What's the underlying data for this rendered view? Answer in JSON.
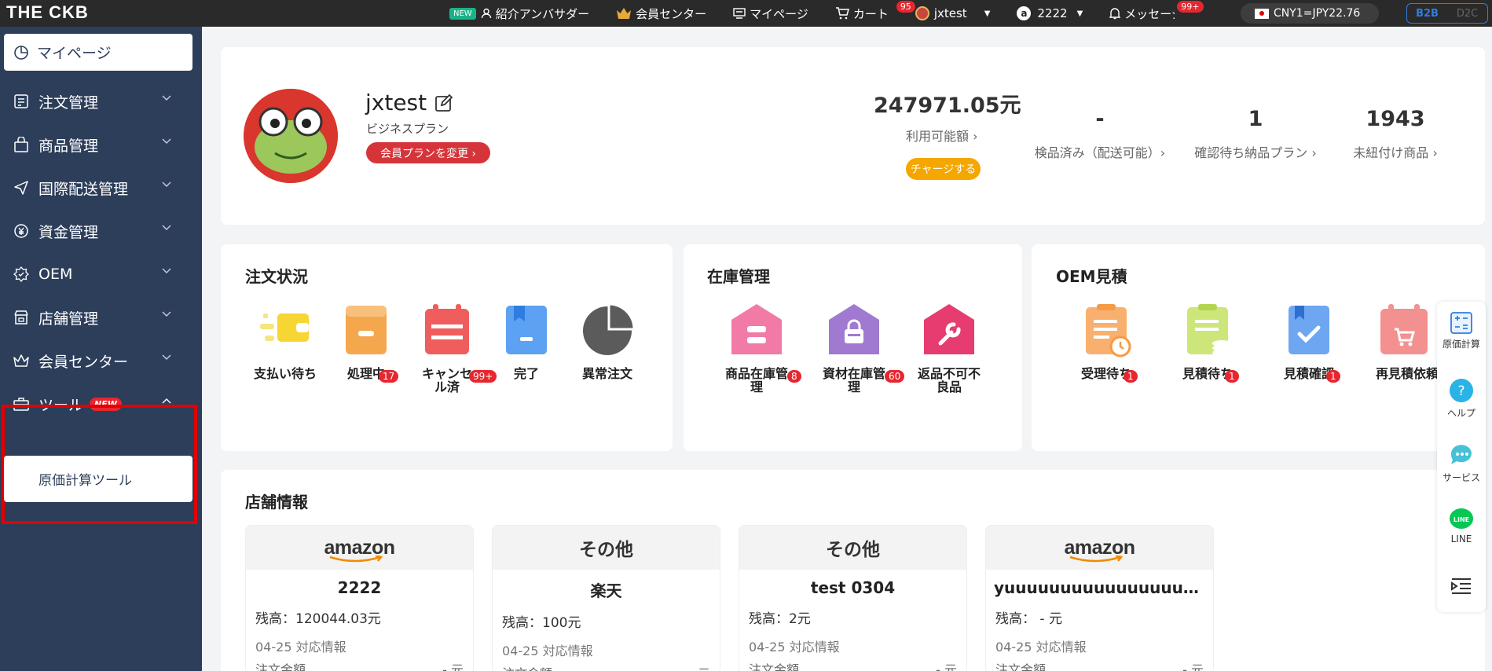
{
  "topbar": {
    "logo": "THE CKB",
    "new_badge": "NEW",
    "ambassador": "紹介アンバサダー",
    "member_center": "会員センター",
    "mypage": "マイページ",
    "cart": "カート",
    "cart_count": "95",
    "user": "jxtest",
    "amazon_account": "2222",
    "messages": "メッセージ",
    "messages_count": "99+",
    "rate": "CNY1=JPY22.76",
    "mode_b2b": "B2B",
    "mode_d2c": "D2C"
  },
  "sidebar": {
    "mypage": "マイページ",
    "items": [
      {
        "label": "注文管理"
      },
      {
        "label": "商品管理"
      },
      {
        "label": "国際配送管理"
      },
      {
        "label": "資金管理"
      },
      {
        "label": "OEM"
      },
      {
        "label": "店舗管理"
      },
      {
        "label": "会員センター"
      },
      {
        "label": "ツール",
        "tag": "NEW"
      }
    ],
    "sub_tool": "原価計算ツール"
  },
  "profile": {
    "username": "jxtest",
    "plan": "ビジネスプラン",
    "change_plan": "会員プランを変更 ›",
    "amount": "247971.05元",
    "amount_label": "利用可能額 ›",
    "charge": "チャージする",
    "stats": [
      {
        "value": "-",
        "label": "検品済み（配送可能）›"
      },
      {
        "value": "1",
        "label": "確認待ち納品プラン ›"
      },
      {
        "value": "1943",
        "label": "未紐付け商品 ›"
      }
    ]
  },
  "order_status": {
    "title": "注文状況",
    "items": [
      {
        "label": "支払い待ち",
        "badge": ""
      },
      {
        "label": "処理中",
        "badge": "17"
      },
      {
        "label": "キャンセル済",
        "badge": "99+"
      },
      {
        "label": "完了",
        "badge": ""
      },
      {
        "label": "異常注文",
        "badge": ""
      }
    ]
  },
  "inventory": {
    "title": "在庫管理",
    "items": [
      {
        "label": "商品在庫管理",
        "badge": "8"
      },
      {
        "label": "資材在庫管理",
        "badge": "60"
      },
      {
        "label": "返品不可不良品",
        "badge": ""
      }
    ]
  },
  "oem": {
    "title": "OEM見積",
    "items": [
      {
        "label": "受理待ち",
        "badge": "1"
      },
      {
        "label": "見積待ち",
        "badge": "1"
      },
      {
        "label": "見積確認",
        "badge": "1"
      },
      {
        "label": "再見積依頼",
        "badge": ""
      }
    ]
  },
  "stores": {
    "title": "店舗情報",
    "cards": [
      {
        "platform": "amazon",
        "name": "2222",
        "balance": "残高：120044.03元",
        "info": "04-25 対応情報",
        "order_label": "注文金額",
        "order_value": "- 元"
      },
      {
        "platform": "その他",
        "name": "楽天",
        "balance": "残高：100元",
        "info": "04-25 対応情報",
        "order_label": "注文金額",
        "order_value": "- 元"
      },
      {
        "platform": "その他",
        "name": "test 0304",
        "balance": "残高：2元",
        "info": "04-25 対応情報",
        "order_label": "注文金額",
        "order_value": "- 元"
      },
      {
        "platform": "amazon",
        "name": "yuuuuuuuuuuuuuuuuuu…",
        "balance": "残高： - 元",
        "info": "04-25 対応情報",
        "order_label": "注文金額",
        "order_value": "- 元"
      }
    ]
  },
  "right_float": {
    "calc": "原価計算",
    "help": "ヘルプ",
    "service": "サービス",
    "line": "LINE"
  }
}
